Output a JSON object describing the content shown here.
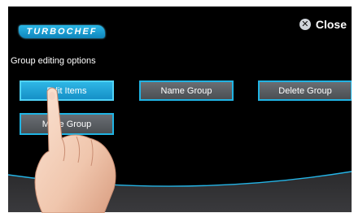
{
  "header": {
    "logo_text": "TURBOCHEF",
    "close_label": "Close",
    "close_icon": "x-circle-icon"
  },
  "main": {
    "subtitle": "Group editing options",
    "buttons": [
      {
        "label": "Edit Items",
        "active": true
      },
      {
        "label": "Name Group",
        "active": false
      },
      {
        "label": "Delete Group",
        "active": false
      },
      {
        "label": "Move Group",
        "active": false
      }
    ]
  },
  "colors": {
    "accent": "#20b3e3",
    "button_fill": "#5b5f63",
    "active_fill": "#1fa3d8",
    "background": "#000000"
  }
}
